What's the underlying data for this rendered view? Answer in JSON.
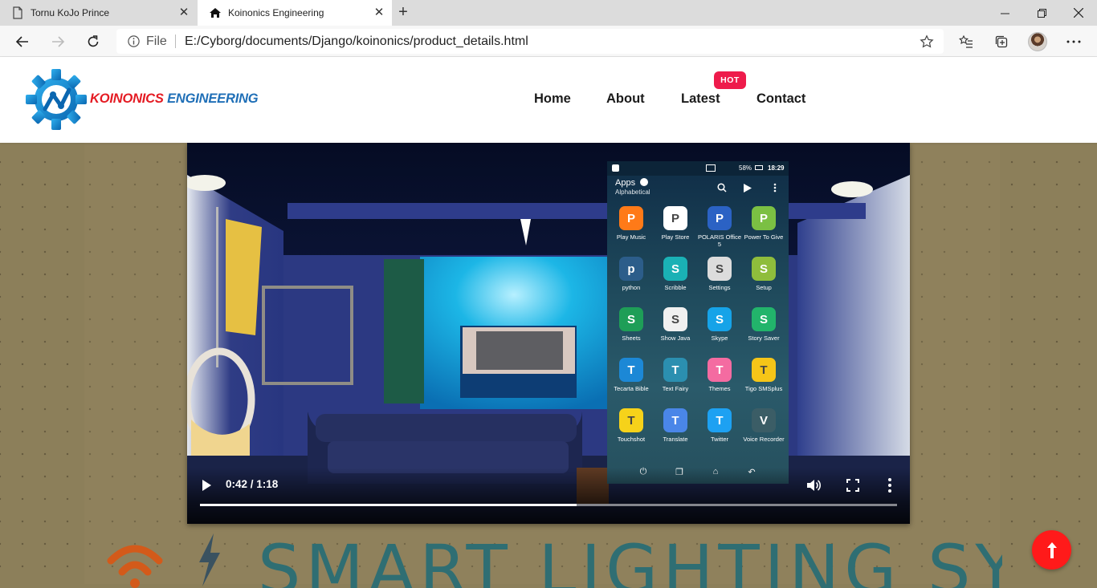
{
  "browser": {
    "tabs": [
      {
        "title": "Tornu KoJo Prince",
        "active": false
      },
      {
        "title": "Koinonics Engineering",
        "active": true
      }
    ],
    "address": {
      "scheme_label": "File",
      "url": "E:/Cyborg/documents/Django/koinonics/product_details.html"
    }
  },
  "site": {
    "brand_part1": "KOINONICS",
    "brand_part2": "ENGINEERING",
    "nav": {
      "home": "Home",
      "about": "About",
      "latest": "Latest",
      "contact": "Contact"
    },
    "hot_badge": "HOT"
  },
  "video": {
    "time": "0:42 / 1:18",
    "progress": 0.54,
    "phone": {
      "status_battery": "58%",
      "status_time": "18:29",
      "apps_title": "Apps",
      "apps_subtitle": "Alphabetical",
      "apps": [
        {
          "label": "Play Music",
          "icon": "play-music-icon",
          "color": "#ff7a18"
        },
        {
          "label": "Play Store",
          "icon": "play-store-icon",
          "color": "#ffffff"
        },
        {
          "label": "POLARIS Office 5",
          "icon": "polaris-office-icon",
          "color": "#2b62c4"
        },
        {
          "label": "Power To Give",
          "icon": "power-to-give-icon",
          "color": "#7bc043"
        },
        {
          "label": "python",
          "icon": "python-icon",
          "color": "#2c5d8a"
        },
        {
          "label": "Scribble",
          "icon": "scribble-icon",
          "color": "#1ab1b5"
        },
        {
          "label": "Settings",
          "icon": "settings-icon",
          "color": "#dcdcdc"
        },
        {
          "label": "Setup",
          "icon": "setup-icon",
          "color": "#8fbd3c"
        },
        {
          "label": "Sheets",
          "icon": "sheets-icon",
          "color": "#1e9e57"
        },
        {
          "label": "Show Java",
          "icon": "show-java-icon",
          "color": "#f0f0f0"
        },
        {
          "label": "Skype",
          "icon": "skype-icon",
          "color": "#16a3e8"
        },
        {
          "label": "Story Saver",
          "icon": "story-saver-icon",
          "color": "#22b46b"
        },
        {
          "label": "Tecarta Bible",
          "icon": "tecarta-bible-icon",
          "color": "#1c88d6"
        },
        {
          "label": "Text Fairy",
          "icon": "text-fairy-icon",
          "color": "#2b8fb0"
        },
        {
          "label": "Themes",
          "icon": "themes-icon",
          "color": "#f46ba1"
        },
        {
          "label": "Tigo SMSplus",
          "icon": "tigo-smsplus-icon",
          "color": "#f5c518"
        },
        {
          "label": "Touchshot",
          "icon": "touchshot-icon",
          "color": "#f6d21a"
        },
        {
          "label": "Translate",
          "icon": "translate-icon",
          "color": "#4a86e8"
        },
        {
          "label": "Twitter",
          "icon": "twitter-icon",
          "color": "#1da1f2"
        },
        {
          "label": "Voice Recorder",
          "icon": "voice-recorder-icon",
          "color": "#3b5d66"
        }
      ]
    }
  },
  "banner_text": "SMART LIGHTING SYSTE",
  "colors": {
    "brand_red": "#e41b23",
    "brand_blue": "#1f6fb7",
    "hot": "#ee1b4b",
    "scroll_top": "#ff1a1a",
    "page_bg": "#8c7f5a"
  }
}
